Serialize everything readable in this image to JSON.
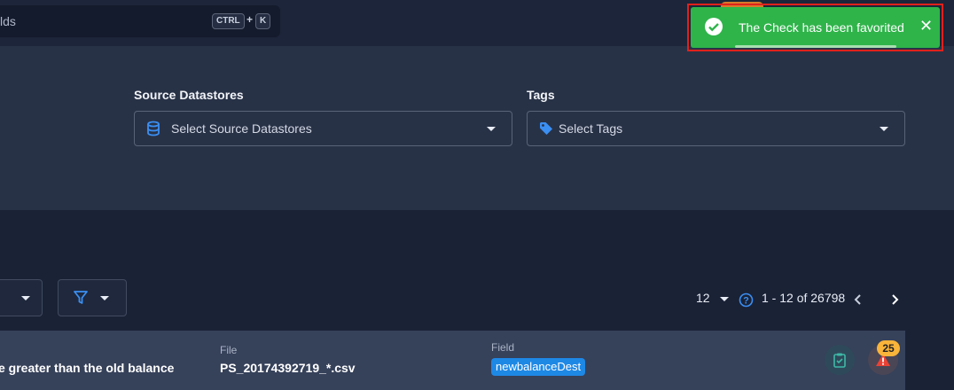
{
  "search": {
    "text": "lds",
    "shortcut_key1": "CTRL",
    "shortcut_plus": "+",
    "shortcut_key2": "K"
  },
  "filters": {
    "source_datastores": {
      "label": "Source Datastores",
      "placeholder": "Select Source Datastores",
      "icon": "database-icon"
    },
    "tags": {
      "label": "Tags",
      "placeholder": "Select Tags",
      "icon": "tag-icon"
    }
  },
  "toolbar": {
    "filter_icon": "filter-icon"
  },
  "pagination": {
    "per_page": "12",
    "range": "1 - 12 of 26798"
  },
  "check_card": {
    "description": "e greater than the old balance",
    "file_label": "File",
    "file_value": "PS_20174392719_*.csv",
    "field_label": "Field",
    "field_value": "newbalanceDest",
    "anomaly_count": "25"
  },
  "toast": {
    "message": "The Check has been favorited",
    "progress": 0.65
  },
  "colors": {
    "toast_bg": "#2fb44a",
    "accent_blue": "#1e88e5",
    "badge_orange": "#f9b43a",
    "alert_red": "#e0211c"
  }
}
